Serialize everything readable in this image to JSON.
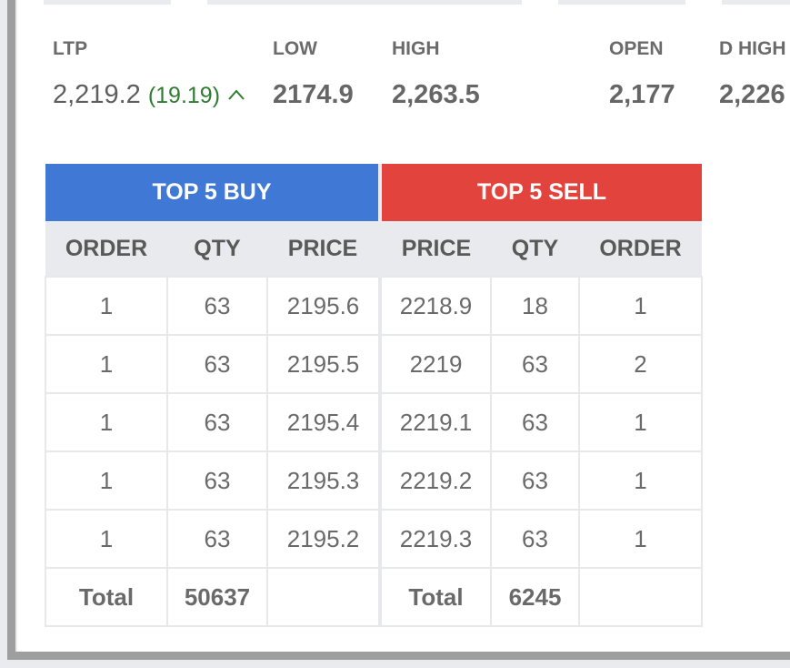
{
  "stats": {
    "ltp": {
      "label": "LTP",
      "value": "2,219.2",
      "change": "(19.19)",
      "change_icon": "up-caret-icon"
    },
    "low": {
      "label": "LOW",
      "value": "2174.9"
    },
    "high": {
      "label": "HIGH",
      "value": "2,263.5"
    },
    "open": {
      "label": "OPEN",
      "value": "2,177"
    },
    "dhigh": {
      "label": "D HIGH",
      "value": "2,226"
    }
  },
  "orderbook": {
    "buy_title": "TOP 5 BUY",
    "sell_title": "TOP 5 SELL",
    "buy_headers": [
      "ORDER",
      "QTY",
      "PRICE"
    ],
    "sell_headers": [
      "PRICE",
      "QTY",
      "ORDER"
    ],
    "rows": [
      {
        "buy_order": "1",
        "buy_qty": "63",
        "buy_price": "2195.6",
        "sell_price": "2218.9",
        "sell_qty": "18",
        "sell_order": "1"
      },
      {
        "buy_order": "1",
        "buy_qty": "63",
        "buy_price": "2195.5",
        "sell_price": "2219",
        "sell_qty": "63",
        "sell_order": "2"
      },
      {
        "buy_order": "1",
        "buy_qty": "63",
        "buy_price": "2195.4",
        "sell_price": "2219.1",
        "sell_qty": "63",
        "sell_order": "1"
      },
      {
        "buy_order": "1",
        "buy_qty": "63",
        "buy_price": "2195.3",
        "sell_price": "2219.2",
        "sell_qty": "63",
        "sell_order": "1"
      },
      {
        "buy_order": "1",
        "buy_qty": "63",
        "buy_price": "2195.2",
        "sell_price": "2219.3",
        "sell_qty": "63",
        "sell_order": "1"
      }
    ],
    "totals": {
      "buy_label": "Total",
      "buy_qty": "50637",
      "sell_label": "Total",
      "sell_qty": "6245"
    }
  },
  "colors": {
    "buy_header": "#4078d6",
    "sell_header": "#e2443d",
    "positive_change": "#2e7d32"
  }
}
